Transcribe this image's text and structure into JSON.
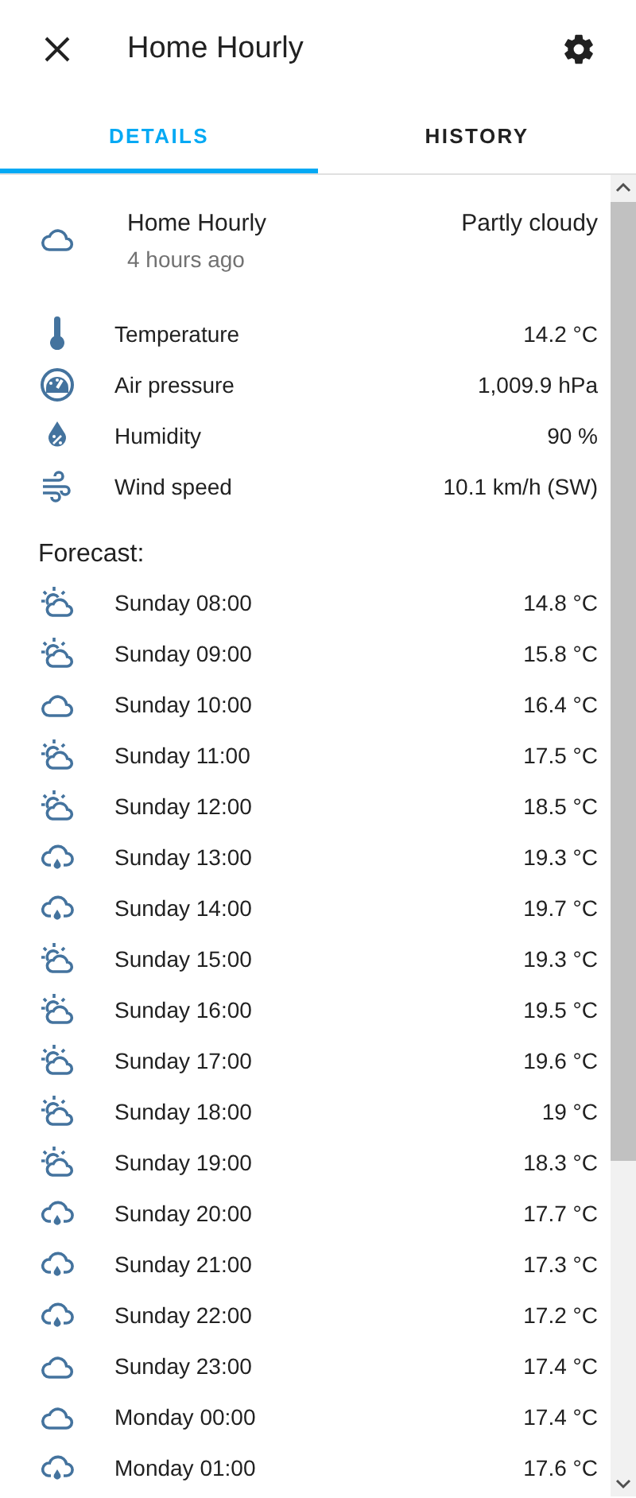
{
  "dialog": {
    "title": "Home Hourly"
  },
  "tabs": [
    {
      "label": "DETAILS",
      "selected": true
    },
    {
      "label": "HISTORY",
      "selected": false
    }
  ],
  "current": {
    "kind": "cloudy",
    "name": "Home Hourly",
    "updated": "4 hours ago",
    "condition": "Partly cloudy"
  },
  "attributes": [
    {
      "kind": "temperature",
      "label": "Temperature",
      "value": "14.2 °C"
    },
    {
      "kind": "pressure",
      "label": "Air pressure",
      "value": "1,009.9 hPa"
    },
    {
      "kind": "humidity",
      "label": "Humidity",
      "value": "90 %"
    },
    {
      "kind": "wind",
      "label": "Wind speed",
      "value": "10.1 km/h (SW)"
    }
  ],
  "forecast_title": "Forecast:",
  "forecast": [
    {
      "kind": "partlycloudy",
      "time": "Sunday 08:00",
      "temp": "14.8 °C"
    },
    {
      "kind": "partlycloudy",
      "time": "Sunday 09:00",
      "temp": "15.8 °C"
    },
    {
      "kind": "cloudy",
      "time": "Sunday 10:00",
      "temp": "16.4 °C"
    },
    {
      "kind": "partlycloudy",
      "time": "Sunday 11:00",
      "temp": "17.5 °C"
    },
    {
      "kind": "partlycloudy",
      "time": "Sunday 12:00",
      "temp": "18.5 °C"
    },
    {
      "kind": "rainy",
      "time": "Sunday 13:00",
      "temp": "19.3 °C"
    },
    {
      "kind": "rainy",
      "time": "Sunday 14:00",
      "temp": "19.7 °C"
    },
    {
      "kind": "partlycloudy",
      "time": "Sunday 15:00",
      "temp": "19.3 °C"
    },
    {
      "kind": "partlycloudy",
      "time": "Sunday 16:00",
      "temp": "19.5 °C"
    },
    {
      "kind": "partlycloudy",
      "time": "Sunday 17:00",
      "temp": "19.6 °C"
    },
    {
      "kind": "partlycloudy",
      "time": "Sunday 18:00",
      "temp": "19 °C"
    },
    {
      "kind": "partlycloudy",
      "time": "Sunday 19:00",
      "temp": "18.3 °C"
    },
    {
      "kind": "rainy",
      "time": "Sunday 20:00",
      "temp": "17.7 °C"
    },
    {
      "kind": "rainy",
      "time": "Sunday 21:00",
      "temp": "17.3 °C"
    },
    {
      "kind": "rainy",
      "time": "Sunday 22:00",
      "temp": "17.2 °C"
    },
    {
      "kind": "cloudy",
      "time": "Sunday 23:00",
      "temp": "17.4 °C"
    },
    {
      "kind": "cloudy",
      "time": "Monday 00:00",
      "temp": "17.4 °C"
    },
    {
      "kind": "rainy",
      "time": "Monday 01:00",
      "temp": "17.6 °C"
    }
  ]
}
